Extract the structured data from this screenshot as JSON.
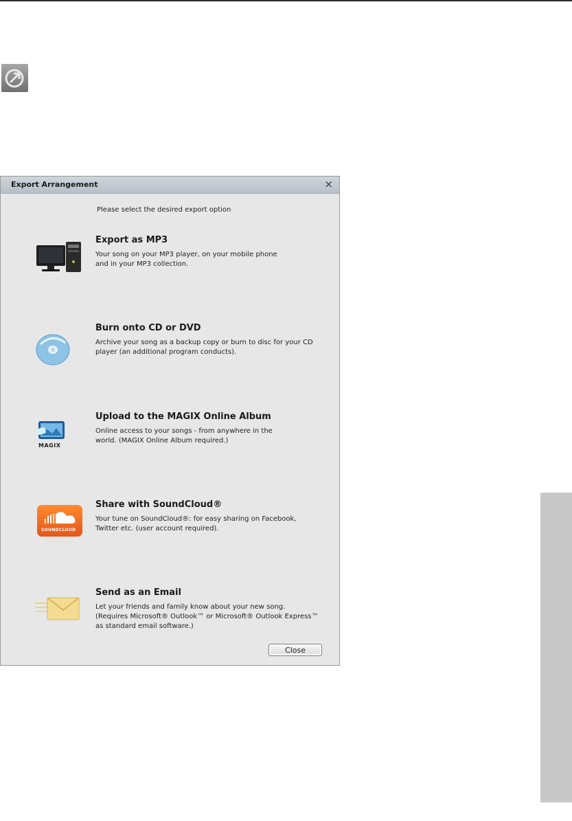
{
  "dialog": {
    "title": "Export Arrangement",
    "close_glyph": "×",
    "prompt": "Please select the desired export option",
    "close_label": "Close"
  },
  "options": [
    {
      "title": "Export as MP3",
      "desc": [
        "Your song on your MP3 player, on your mobile phone",
        "and in your MP3 collection."
      ],
      "icon": "computer-icon"
    },
    {
      "title": "Burn onto CD or DVD",
      "desc": [
        "Archive your song as a backup copy or burn to disc for your CD",
        " player (an additional program conducts)."
      ],
      "icon": "disc-icon"
    },
    {
      "title": "Upload to the MAGIX Online Album",
      "desc": [
        "Online access to your songs - from anywhere in the",
        "world. (MAGIX Online Album required.)"
      ],
      "icon": "magix-album-icon",
      "icon_text": "MAGIX"
    },
    {
      "title": "Share with SoundCloud®",
      "desc": [
        "Your tune on SoundCloud®: for easy sharing on Facebook,",
        "Twitter etc. (user account required)."
      ],
      "icon": "soundcloud-icon",
      "icon_text": "SOUNDCLOUD"
    },
    {
      "title": "Send as an Email",
      "desc": [
        "Let your friends and family know about your new song.",
        "(Requires Microsoft® Outlook™ or Microsoft® Outlook Express™",
        " as standard email software.)"
      ],
      "icon": "email-icon"
    }
  ],
  "colors": {
    "soundcloud_orange": "#f26b1d",
    "dialog_bg": "#e7e7e7",
    "titlebar": "#c4ccd3",
    "side_tab": "#c8c8c8"
  }
}
